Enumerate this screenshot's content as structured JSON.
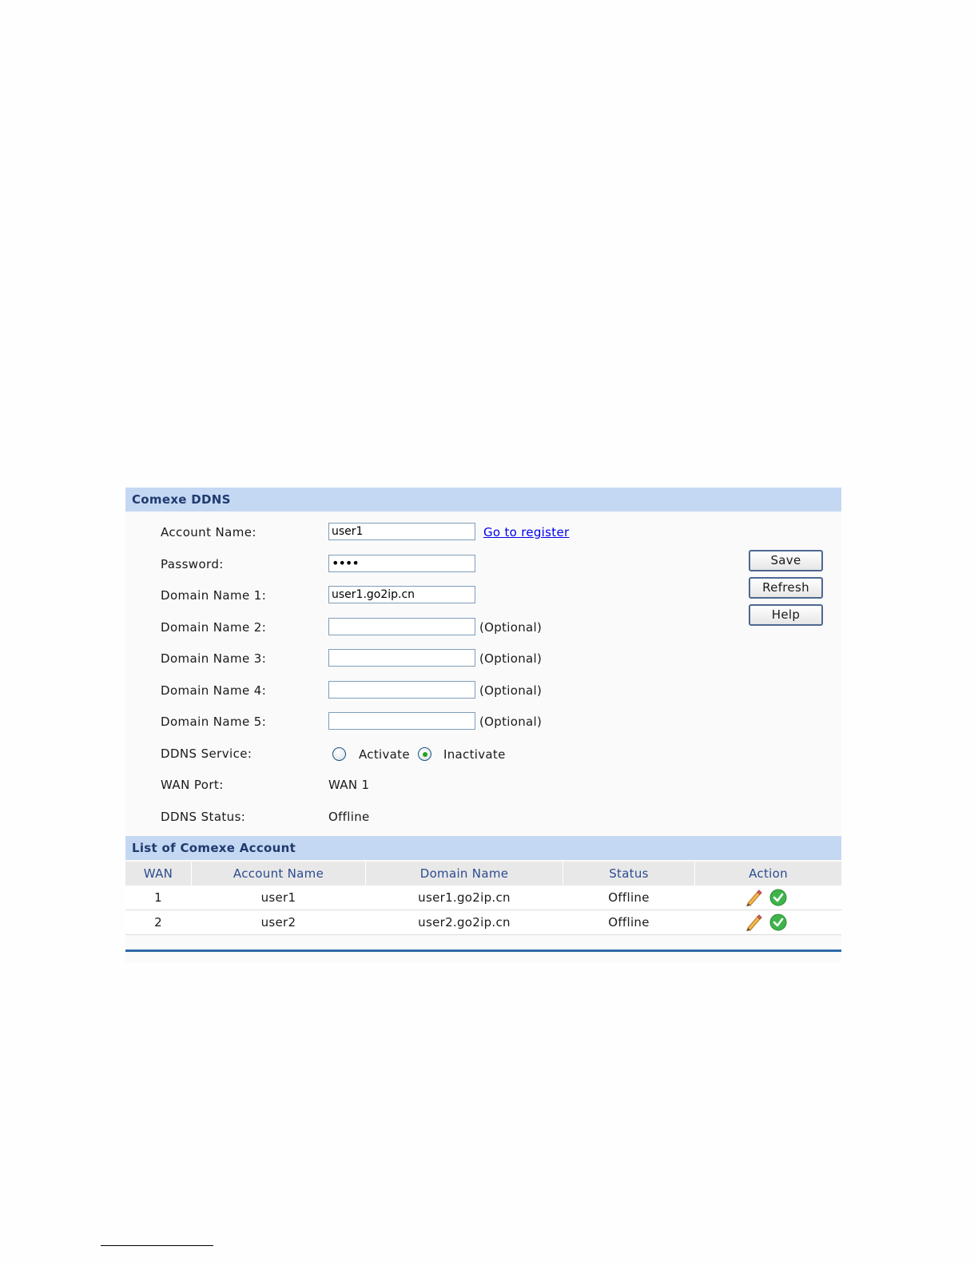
{
  "ddns": {
    "title": "Comexe DDNS",
    "account_label": "Account Name:",
    "account_value": "user1",
    "register_link": "Go to register",
    "password_label": "Password:",
    "password_value": "••••",
    "domain1_label": "Domain Name 1:",
    "domain1_value": "user1.go2ip.cn",
    "domain2_label": "Domain Name 2:",
    "domain3_label": "Domain Name 3:",
    "domain4_label": "Domain Name 4:",
    "domain5_label": "Domain Name 5:",
    "optional_text": "(Optional)",
    "service_label": "DDNS Service:",
    "service_options": [
      "Activate",
      "Inactivate"
    ],
    "service_selected": "Inactivate",
    "wan_port_label": "WAN Port:",
    "wan_port_value": "WAN 1",
    "status_label": "DDNS Status:",
    "status_value": "Offline"
  },
  "buttons": {
    "save": "Save",
    "refresh": "Refresh",
    "help": "Help"
  },
  "accounts": {
    "title": "List of Comexe Account",
    "columns": [
      "WAN",
      "Account Name",
      "Domain Name",
      "Status",
      "Action"
    ],
    "rows": [
      {
        "wan": "1",
        "account": "user1",
        "domain": "user1.go2ip.cn",
        "status": "Offline",
        "actions": [
          "edit-icon",
          "check-icon"
        ]
      },
      {
        "wan": "2",
        "account": "user2",
        "domain": "user2.go2ip.cn",
        "status": "Offline",
        "actions": [
          "edit-icon",
          "check-icon"
        ]
      }
    ]
  },
  "colors": {
    "header_bg": "#c4d8f3",
    "header_text": "#203a6e",
    "column_text": "#2b4c8f",
    "link": "#0000ee",
    "selected_radio": "#21a121"
  }
}
